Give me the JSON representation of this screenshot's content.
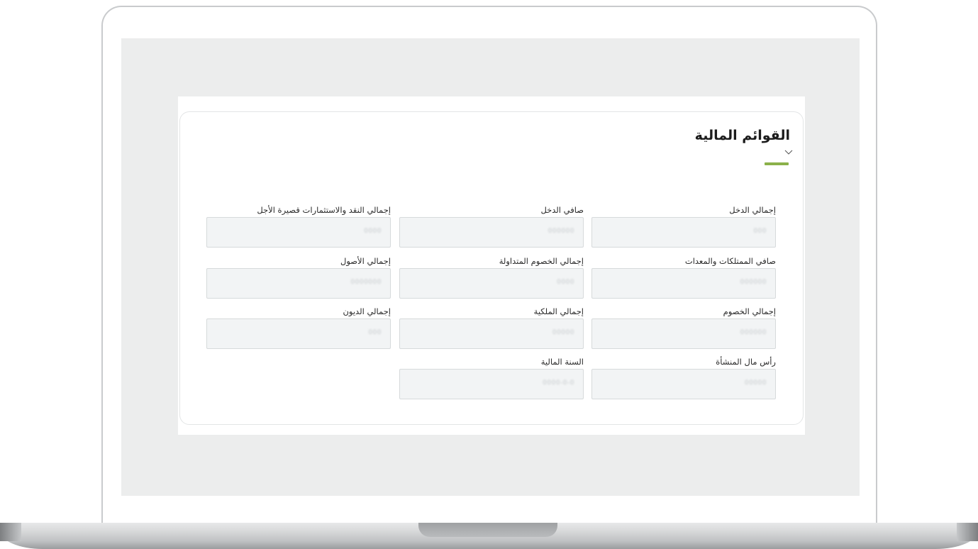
{
  "section": {
    "title": "القوائم المالية",
    "accent_color": "#8bb14a",
    "toggle_icon": "chevron-down-icon"
  },
  "fields": {
    "total_income": {
      "label": "إجمالي الدخل",
      "value": "000"
    },
    "net_income": {
      "label": "صافي الدخل",
      "value": "000000"
    },
    "total_cash_short_term": {
      "label": "إجمالي النقد والاستثمارات قصيرة الأجل",
      "value": "0000"
    },
    "net_property_equipment": {
      "label": "صافي الممتلكات والمعدات",
      "value": "000000"
    },
    "total_current_liabilities": {
      "label": "إجمالي الخصوم المتداولة",
      "value": "0000"
    },
    "total_assets": {
      "label": "إجمالي الأصول",
      "value": "0000000"
    },
    "total_liabilities": {
      "label": "إجمالي الخصوم",
      "value": "000000"
    },
    "total_equity": {
      "label": "إجمالي الملكية",
      "value": "00000"
    },
    "total_debts": {
      "label": "إجمالي الديون",
      "value": "000"
    },
    "capital": {
      "label": "رأس مال المنشأة",
      "value": "00000"
    },
    "fiscal_year": {
      "label": "السنة المالية",
      "value": "0000-0-0"
    }
  }
}
